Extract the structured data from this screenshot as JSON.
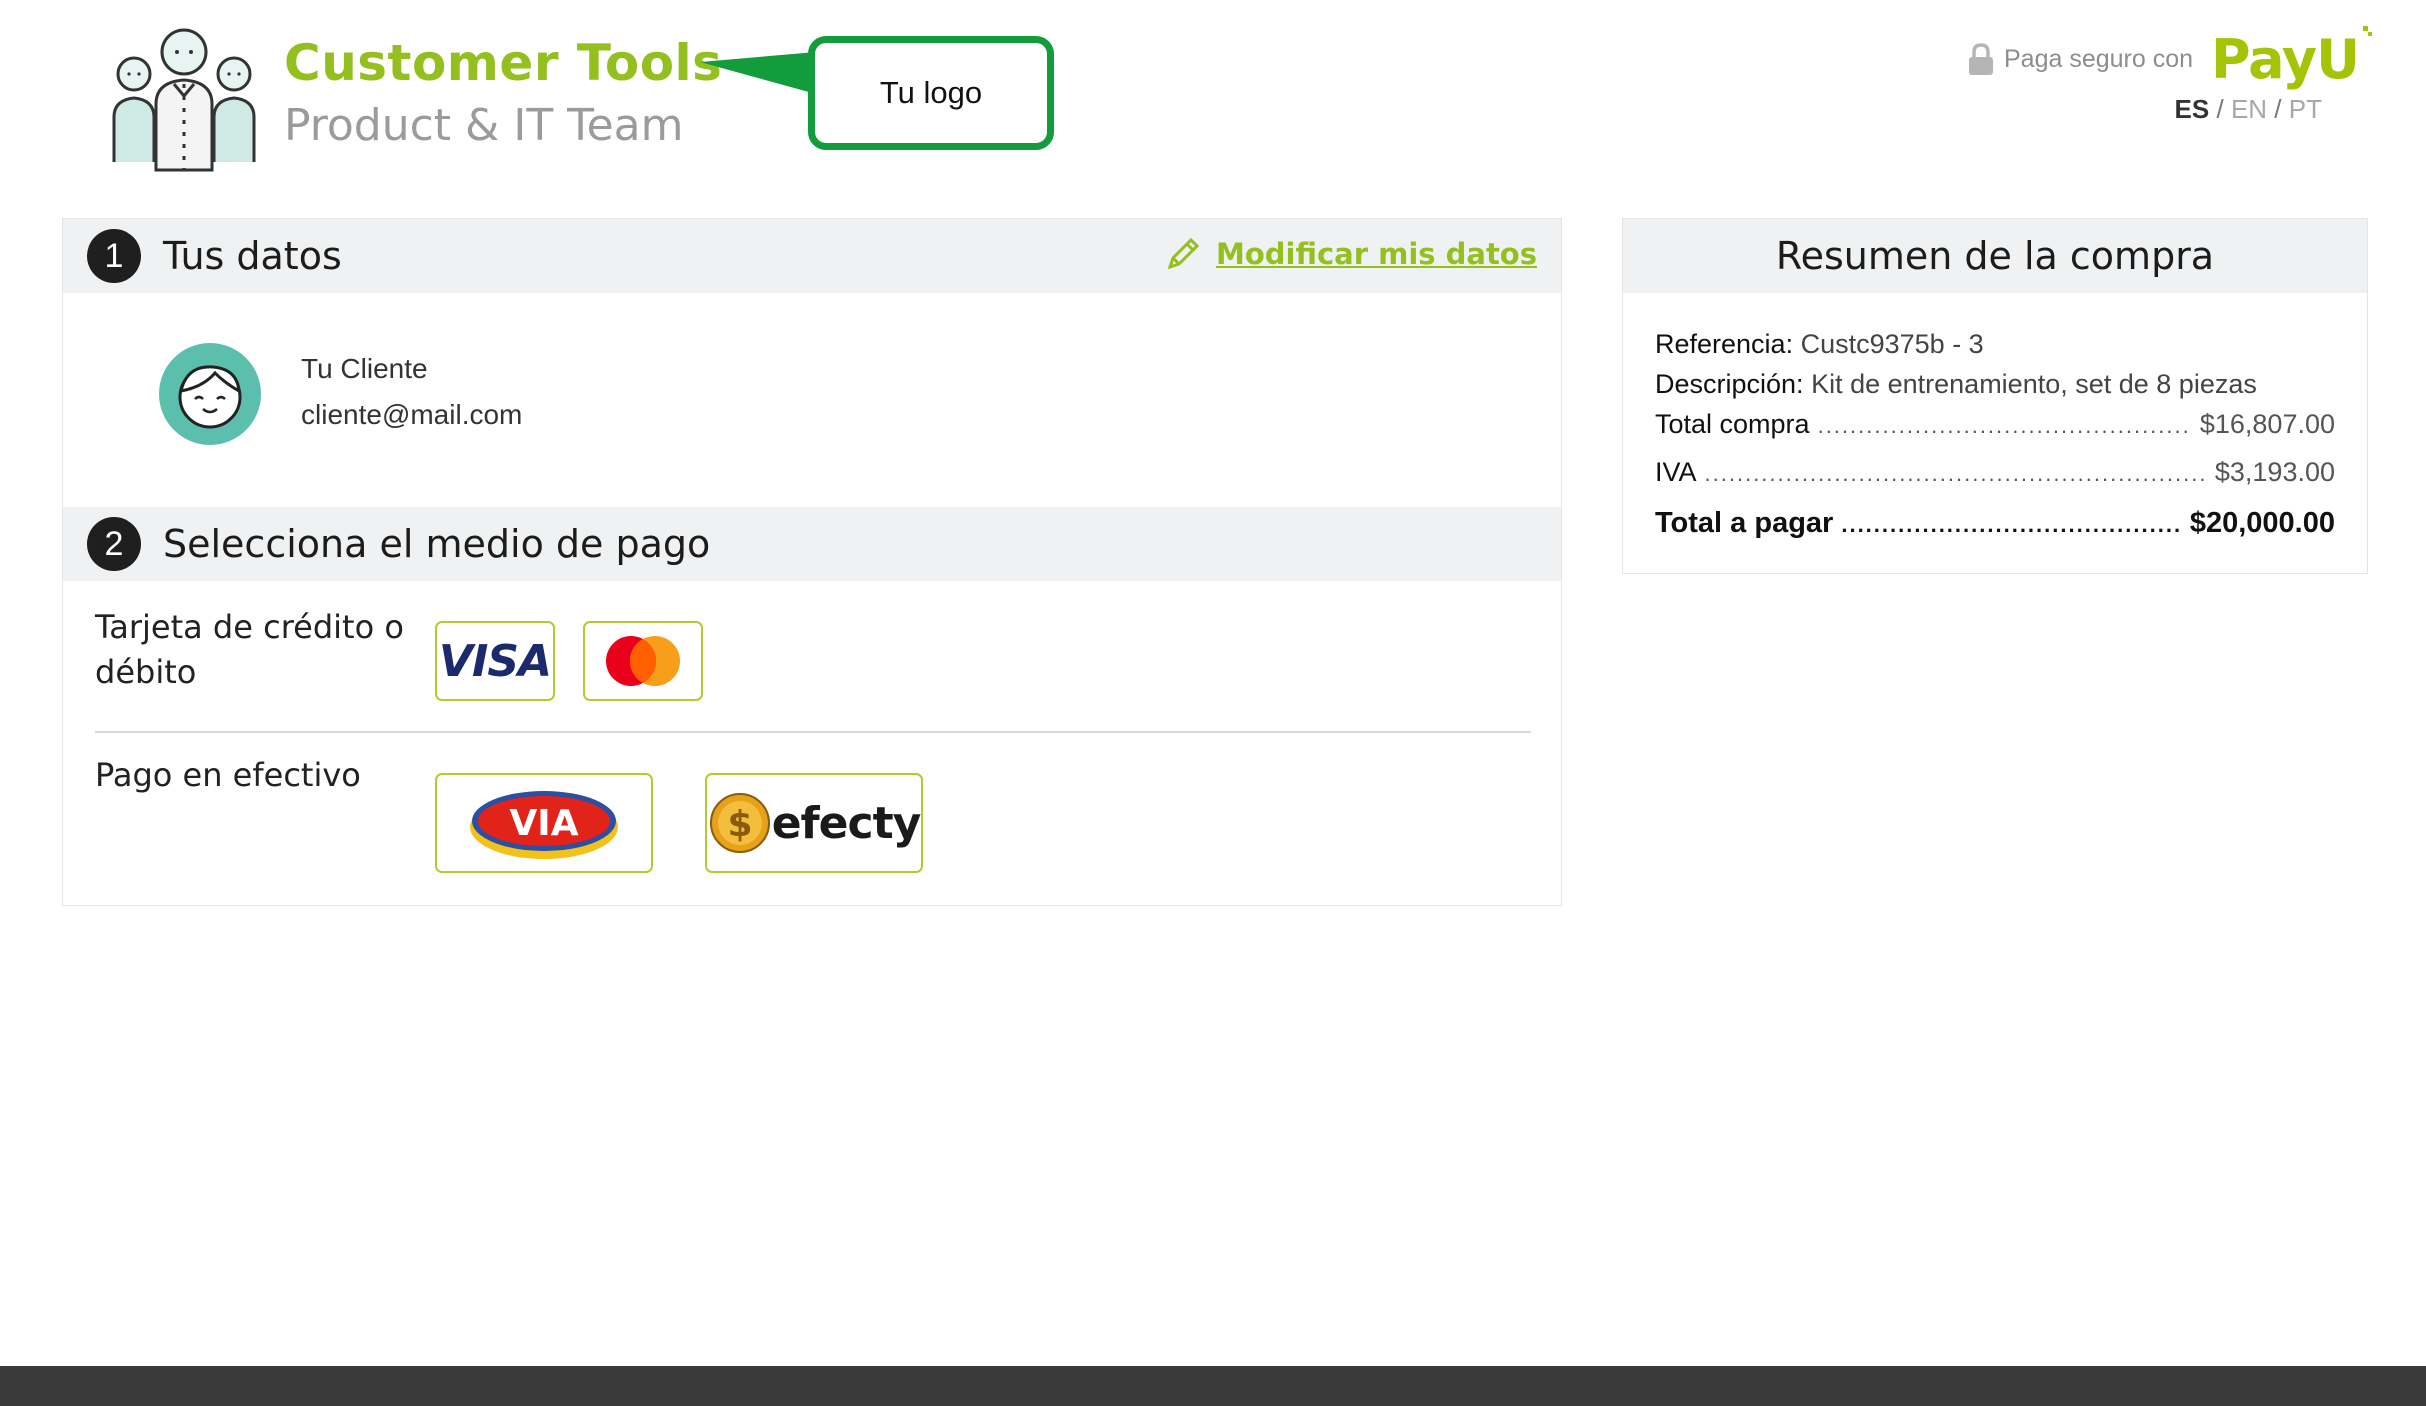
{
  "header": {
    "brand_name": "Customer Tools",
    "brand_sub": "Product & IT Team",
    "callout_text": "Tu logo",
    "secure_text": "Paga seguro con",
    "payu_logo": "PayU",
    "languages": {
      "es": "ES",
      "en": "EN",
      "pt": "PT",
      "separator": "/"
    }
  },
  "section1": {
    "number": "1",
    "title": "Tus datos",
    "modify_label": "Modificar mis datos",
    "customer_name": "Tu Cliente",
    "customer_email": "cliente@mail.com"
  },
  "section2": {
    "number": "2",
    "title": "Selecciona el medio de pago",
    "card_label": "Tarjeta de crédito o débito",
    "cash_label": "Pago en efectivo",
    "methods": {
      "visa": "VISA",
      "via": "VIA",
      "efecty": "efecty"
    }
  },
  "summary": {
    "title": "Resumen de la compra",
    "reference_label": "Referencia:",
    "reference_value": "Custc9375b - 3",
    "description_label": "Descripción:",
    "description_value": "Kit de entrenamiento, set de 8 piezas",
    "total_compra_label": "Total compra",
    "total_compra_value": "$16,807.00",
    "iva_label": "IVA",
    "iva_value": "$3,193.00",
    "total_pagar_label": "Total a pagar",
    "total_pagar_value": "$20,000.00"
  },
  "colors": {
    "brand_green": "#93c01f",
    "callout_green": "#129c3b",
    "section_header_bg": "#eff1f2",
    "footer": "#3a3a3a"
  }
}
